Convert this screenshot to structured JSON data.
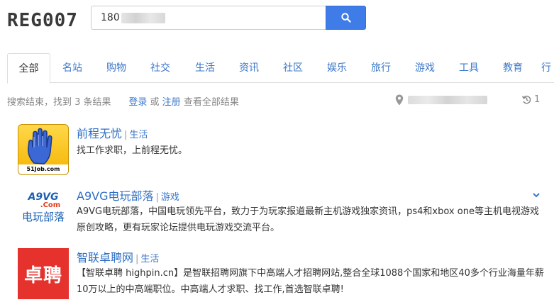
{
  "logo": "REG007",
  "search": {
    "value": "180"
  },
  "tabs": [
    {
      "label": "全部"
    },
    {
      "label": "名站"
    },
    {
      "label": "购物"
    },
    {
      "label": "社交"
    },
    {
      "label": "生活"
    },
    {
      "label": "资讯"
    },
    {
      "label": "社区"
    },
    {
      "label": "娱乐"
    },
    {
      "label": "旅行"
    },
    {
      "label": "游戏"
    },
    {
      "label": "工具"
    },
    {
      "label": "教育"
    },
    {
      "label": "行"
    }
  ],
  "status": {
    "result_text": "搜索结束，找到 3 条结果",
    "login": "登录",
    "or": "或",
    "register": "注册",
    "view_all": "查看全部结果",
    "history_count": "1"
  },
  "results": [
    {
      "title": "前程无忧",
      "sep": "|",
      "category": "生活",
      "desc": "找工作求职，上前程无忧。",
      "logo_text": "51Job.com"
    },
    {
      "title": "A9VG电玩部落",
      "sep": "|",
      "category": "游戏",
      "desc": "A9VG电玩部落，中国电玩领先平台，致力于为玩家报道最新主机游戏独家资讯，ps4和xbox one等主机电视游戏原创攻略，更有玩家论坛提供电玩游戏交流平台。",
      "logo_brand": "A9VG",
      "logo_com": ".Com",
      "logo_cn": "电玩部落"
    },
    {
      "title": "智联卓聘网",
      "sep": "|",
      "category": "生活",
      "desc": "【智联卓聘 highpin.cn】是智联招聘网旗下中高端人才招聘网站,整合全球1088个国家和地区40多个行业海量年薪10万以上的中高端职位。中高端人才求职、找工作,首选智联卓聘!",
      "logo_text": "卓聘"
    }
  ],
  "colors": {
    "accent": "#3f7ce8",
    "link": "#2f6fc4",
    "zhuopin_red": "#e5322d"
  }
}
